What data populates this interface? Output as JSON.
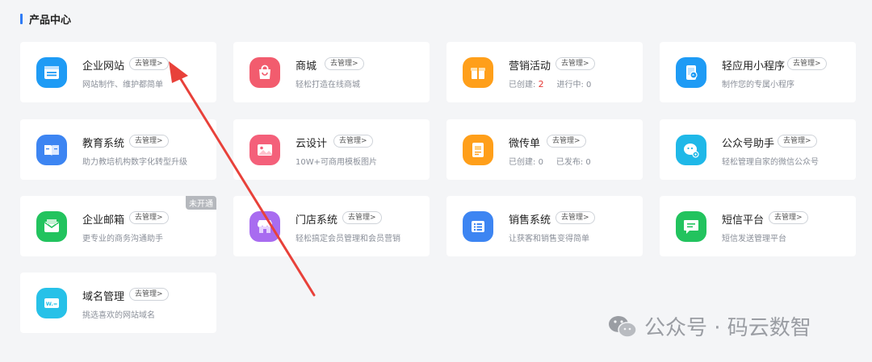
{
  "section": {
    "title": "产品中心"
  },
  "manage_label": "去管理>",
  "cards": {
    "website": {
      "name": "企业网站",
      "desc": "网站制作、维护都简单"
    },
    "mall": {
      "name": "商城",
      "desc": "轻松打造在线商城"
    },
    "marketing": {
      "name": "营销活动",
      "created_label": "已创建:",
      "created_value": "2",
      "running_label": "进行中:",
      "running_value": "0"
    },
    "miniapp": {
      "name": "轻应用小程序",
      "desc": "制作您的专属小程序"
    },
    "education": {
      "name": "教育系统",
      "desc": "助力教培机构数字化转型升级"
    },
    "clouddesign": {
      "name": "云设计",
      "desc": "10W+可商用模板图片"
    },
    "flyer": {
      "name": "微传单",
      "created_label": "已创建:",
      "created_value": "0",
      "published_label": "已发布:",
      "published_value": "0"
    },
    "official": {
      "name": "公众号助手",
      "desc": "轻松管理自家的微信公众号"
    },
    "email": {
      "name": "企业邮箱",
      "desc": "更专业的商务沟通助手",
      "badge": "未开通"
    },
    "store": {
      "name": "门店系统",
      "desc": "轻松搞定会员管理和会员营销"
    },
    "sales": {
      "name": "销售系统",
      "desc": "让获客和销售变得简单"
    },
    "sms": {
      "name": "短信平台",
      "desc": "短信发送管理平台"
    },
    "domain": {
      "name": "域名管理",
      "desc": "挑选喜欢的网站域名"
    }
  },
  "icon_names": [
    "website-icon",
    "mall-icon",
    "marketing-icon",
    "miniapp-icon",
    "education-icon",
    "design-icon",
    "flyer-icon",
    "official-account-icon",
    "email-icon",
    "store-icon",
    "sales-icon",
    "sms-icon",
    "domain-icon"
  ],
  "watermark": {
    "text": "公众号 · 码云数智"
  },
  "colors": {
    "accent": "#2f7bf6",
    "badge": "#b5b8bd",
    "arrow": "#e8413a",
    "count_red": "#e53935"
  }
}
